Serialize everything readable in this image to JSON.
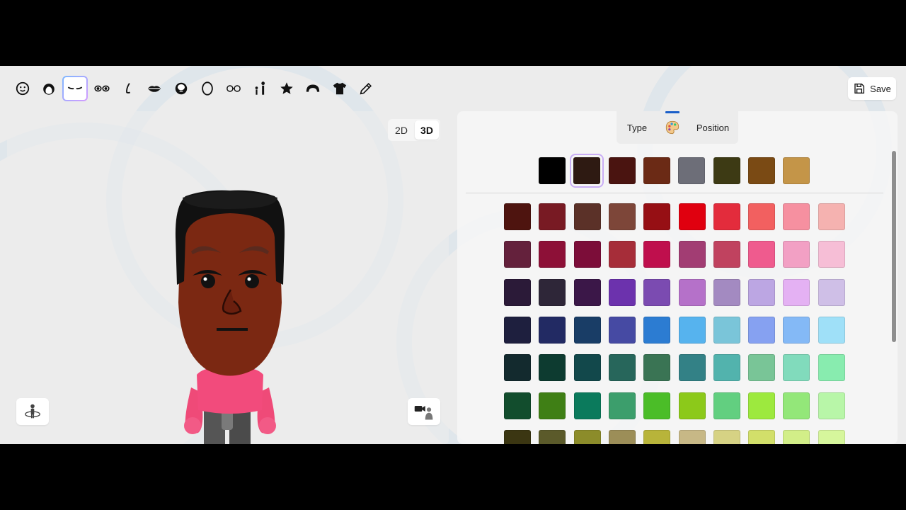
{
  "toolbar": {
    "tools": [
      {
        "name": "face-tool",
        "icon": "face-icon"
      },
      {
        "name": "hair-tool",
        "icon": "hair-icon"
      },
      {
        "name": "eyebrows-tool",
        "icon": "eyebrows-icon",
        "active": true
      },
      {
        "name": "eyes-tool",
        "icon": "eyes-icon"
      },
      {
        "name": "nose-tool",
        "icon": "nose-icon"
      },
      {
        "name": "mouth-tool",
        "icon": "mouth-icon"
      },
      {
        "name": "beard-tool",
        "icon": "beard-icon"
      },
      {
        "name": "head-shape-tool",
        "icon": "head-shape-icon"
      },
      {
        "name": "glasses-tool",
        "icon": "glasses-icon"
      },
      {
        "name": "body-tool",
        "icon": "body-height-icon"
      },
      {
        "name": "favorite-tool",
        "icon": "star-icon"
      },
      {
        "name": "hat-tool",
        "icon": "hat-icon"
      },
      {
        "name": "clothes-tool",
        "icon": "shirt-icon"
      },
      {
        "name": "edit-tool",
        "icon": "pencil-icon"
      }
    ],
    "save_label": "Save",
    "save_icon": "save-icon"
  },
  "preview": {
    "view_2d": "2D",
    "view_3d": "3D",
    "active_view": "3D",
    "rotate_icon": "rotate-avatar-icon",
    "camera_icon": "camera-avatar-icon"
  },
  "panel": {
    "tab_type": "Type",
    "tab_color_icon": "palette-icon",
    "tab_position": "Position",
    "active_tab": "color",
    "accent": "#1a5fc9",
    "quick_colors": [
      "#000000",
      "#2e1a12",
      "#4a1410",
      "#6b2a15",
      "#6d6e78",
      "#3d3a14",
      "#7a4a14",
      "#c49548"
    ],
    "selected_quick_index": 1,
    "palette": [
      [
        "#4e140f",
        "#781a23",
        "#5b3128",
        "#7d4639",
        "#960f14",
        "#e0000f",
        "#e32c3c",
        "#f26060",
        "#f690a0",
        "#f5b2b0"
      ],
      [
        "#64213c",
        "#8d1037",
        "#7c0d39",
        "#a62d39",
        "#bf0f4d",
        "#a23d73",
        "#c0425f",
        "#ef5b8e",
        "#f2a0c4",
        "#f6bed6"
      ],
      [
        "#2b1a38",
        "#2e2638",
        "#3b1748",
        "#6c32ad",
        "#7b4bb1",
        "#b571c9",
        "#a38ac1",
        "#bca6e3",
        "#e4b1f3",
        "#cfbfe7"
      ],
      [
        "#1e1f3e",
        "#222a63",
        "#193d66",
        "#464aa3",
        "#2c7cd2",
        "#56b3ee",
        "#7ac5d9",
        "#86a1f1",
        "#84b9f6",
        "#9fe0f8"
      ],
      [
        "#132a2e",
        "#0d3b30",
        "#12484b",
        "#27665b",
        "#3a7454",
        "#338186",
        "#52b3ad",
        "#79c597",
        "#81dbbc",
        "#88ecaf"
      ],
      [
        "#124d2d",
        "#3f7f15",
        "#0b7a5c",
        "#3c9e6c",
        "#4bbd28",
        "#8cc91a",
        "#62cf80",
        "#9de93e",
        "#93e779",
        "#b8f6a8"
      ],
      [
        "#3b3612",
        "#5b5a2a",
        "#8c8c2a",
        "#9c8e58",
        "#b8b43a",
        "#c7b886",
        "#d6d284",
        "#d2df6a",
        "#d2ee88",
        "#d6f69c"
      ]
    ]
  }
}
